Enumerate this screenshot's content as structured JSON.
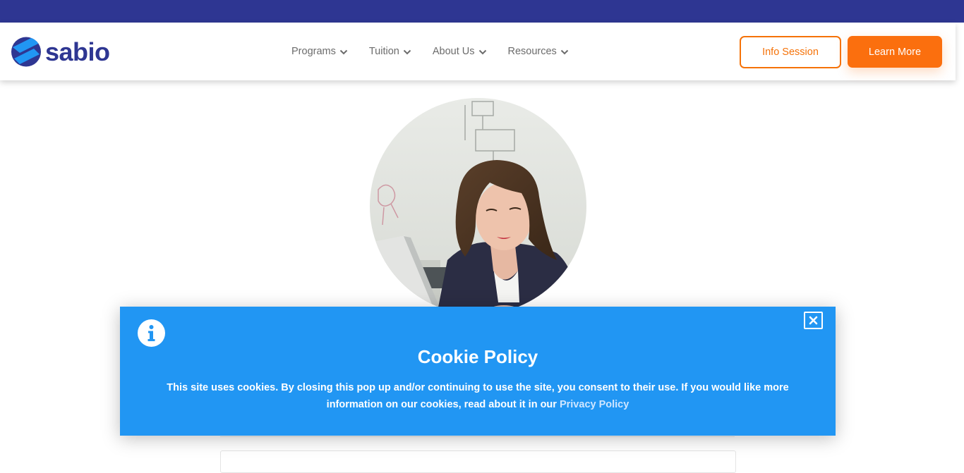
{
  "brand": {
    "name": "sabio"
  },
  "nav": {
    "items": [
      {
        "label": "Programs"
      },
      {
        "label": "Tuition"
      },
      {
        "label": "About Us"
      },
      {
        "label": "Resources"
      }
    ]
  },
  "header": {
    "info_session_label": "Info Session",
    "learn_more_label": "Learn More"
  },
  "cookie": {
    "title": "Cookie Policy",
    "text": "This site uses cookies. By closing this pop up and/or continuing to use the site, you consent to their use. If you would like more information on our cookies, read about it in our",
    "link_label": "Privacy Policy"
  },
  "colors": {
    "top_strip": "#2e3692",
    "accent_orange": "#fb6f0e",
    "cookie_bg": "#2196f3",
    "brand_blue": "#2e3692"
  },
  "icons": [
    "chevron-down-icon",
    "info-icon",
    "close-icon"
  ]
}
